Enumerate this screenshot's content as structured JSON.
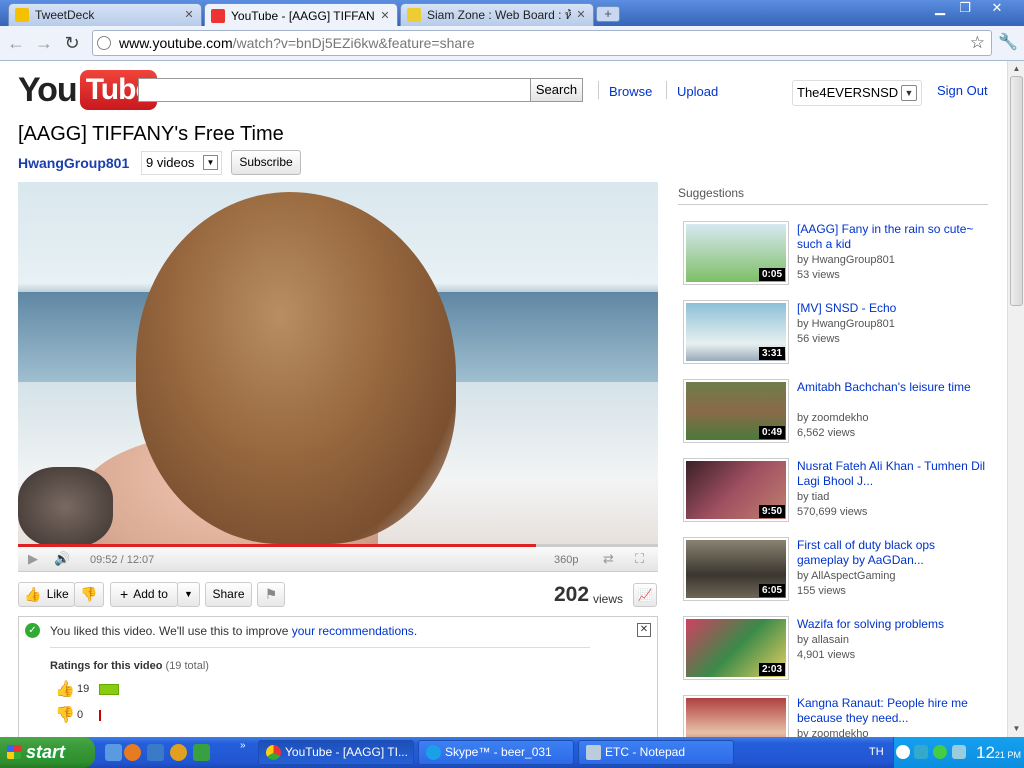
{
  "browser": {
    "tabs": [
      {
        "label": "TweetDeck",
        "active": false
      },
      {
        "label": "YouTube - [AAGG] TIFFAN...",
        "active": true
      },
      {
        "label": "Siam Zone : Web Board : ห้...",
        "active": false
      }
    ],
    "new_tab": "+",
    "url_host": "www.youtube.com",
    "url_path": "/watch?v=bnDj5EZi6kw&feature=share"
  },
  "header": {
    "logo_you": "You",
    "logo_tube": "Tube",
    "search_label": "Search",
    "browse": "Browse",
    "upload": "Upload",
    "username": "The4EVERSNSD",
    "sign_out": "Sign Out"
  },
  "video": {
    "title": "[AAGG] TIFFANY's Free Time",
    "channel": "HwangGroup801",
    "videos_count": "9 videos",
    "subscribe": "Subscribe",
    "time": "09:52 / 12:07",
    "quality": "360p",
    "progress": 0.81,
    "views": "202",
    "views_label": "views"
  },
  "actions": {
    "like": "Like",
    "add_to": "Add to",
    "share": "Share"
  },
  "liked": {
    "message": "You liked this video. We'll use this to improve ",
    "link": "your recommendations",
    "period": ".",
    "ratings_title": "Ratings for this video",
    "ratings_total": "(19 total)",
    "likes": "19",
    "dislikes": "0"
  },
  "suggestions": {
    "heading": "Suggestions",
    "items": [
      {
        "title": "[AAGG] Fany in the rain so cute~ such a kid",
        "by": "by HwangGroup801",
        "views": "53 views",
        "duration": "0:05",
        "thumb": "#7fbf66"
      },
      {
        "title": "[MV] SNSD - Echo",
        "by": "by HwangGroup801",
        "views": "56 views",
        "duration": "3:31",
        "thumb": "#8cc0d8"
      },
      {
        "title": "Amitabh Bachchan's leisure time",
        "by": "by zoomdekho",
        "views": "6,562 views",
        "duration": "0:49",
        "thumb": "#5d7a3c"
      },
      {
        "title": "Nusrat Fateh Ali Khan - Tumhen Dil Lagi Bhool J...",
        "by": "by tiad",
        "views": "570,699 views",
        "duration": "9:50",
        "thumb": "#8a3a4a"
      },
      {
        "title": "First call of duty black ops gameplay by AaGDan...",
        "by": "by AllAspectGaming",
        "views": "155 views",
        "duration": "6:05",
        "thumb": "#6e6656"
      },
      {
        "title": "Wazifa for solving problems",
        "by": "by allasain",
        "views": "4,901 views",
        "duration": "2:03",
        "thumb": "#3a8a4a"
      },
      {
        "title": "Kangna Ranaut: People hire me because they need...",
        "by": "by zoomdekho",
        "views": "",
        "duration": "",
        "thumb": "#b04040"
      }
    ]
  },
  "taskbar": {
    "start": "start",
    "tasks": [
      {
        "label": "YouTube - [AAGG] TI...",
        "active": true
      },
      {
        "label": "Skype™ - beer_031",
        "active": false
      },
      {
        "label": "ETC - Notepad",
        "active": false
      }
    ],
    "lang": "TH",
    "clock": "12",
    "clock_min": "21",
    "clock_ampm": "PM"
  }
}
